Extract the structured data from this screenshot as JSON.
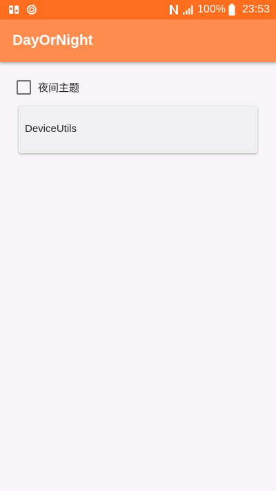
{
  "status_bar": {
    "background": "#ff6d1f",
    "left_icons": [
      "app-notification-icon",
      "sync-notification-icon"
    ],
    "right_icons": [
      "nfc-icon",
      "signal-icon",
      "battery-icon"
    ],
    "battery_percent": "100%",
    "time": "23:53"
  },
  "app_bar": {
    "title": "DayOrNight",
    "background": "#ff8c4f"
  },
  "night_theme_checkbox": {
    "label": "夜间主题",
    "checked": false
  },
  "device_utils_button": {
    "label": "DeviceUtils"
  },
  "colors": {
    "page_background": "#f7f5f7",
    "button_background": "#f0eff2"
  }
}
